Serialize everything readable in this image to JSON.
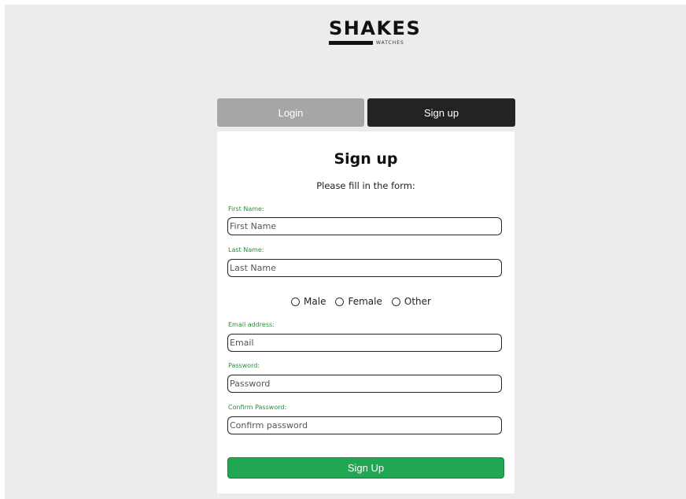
{
  "logo": {
    "word": "SHAKES",
    "sub": "WATCHES"
  },
  "tabs": {
    "login": "Login",
    "signup": "Sign up"
  },
  "form": {
    "title": "Sign up",
    "subtitle": "Please fill in the form:",
    "fields": {
      "first_name": {
        "label": "First Name:",
        "placeholder": "First Name"
      },
      "last_name": {
        "label": "Last Name:",
        "placeholder": "Last Name"
      },
      "email": {
        "label": "Email address:",
        "placeholder": "Email"
      },
      "password": {
        "label": "Password:",
        "placeholder": "Password"
      },
      "confirm_password": {
        "label": "Confirm Password:",
        "placeholder": "Confirm password"
      }
    },
    "gender": {
      "options": [
        "Male",
        "Female",
        "Other"
      ]
    },
    "submit_label": "Sign Up"
  },
  "colors": {
    "accent_green": "#21a652",
    "label_green": "#2e8b3e",
    "tab_active": "#232323",
    "tab_inactive": "#a6a6a6",
    "background": "#ececec"
  }
}
